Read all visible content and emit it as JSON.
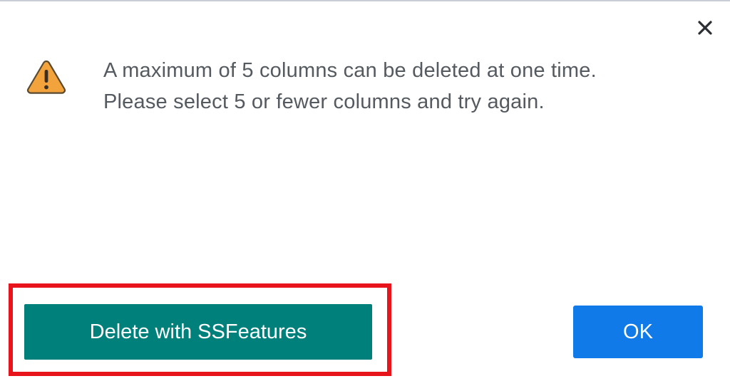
{
  "dialog": {
    "message": "A maximum of 5 columns can be deleted at one time. Please select 5 or fewer columns and try again.",
    "icons": {
      "warning": "warning-icon",
      "close": "close-icon"
    },
    "buttons": {
      "delete_label": "Delete with SSFeatures",
      "ok_label": "OK"
    },
    "colors": {
      "delete_button": "#00807a",
      "ok_button": "#0f7ae8",
      "highlight": "#e8141c",
      "warning_fill": "#f3a33b"
    }
  }
}
